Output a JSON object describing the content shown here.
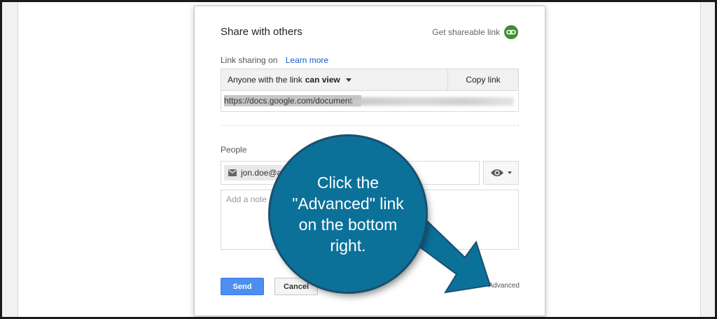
{
  "dialog": {
    "title": "Share with others",
    "shareable_link_label": "Get shareable link"
  },
  "link_sharing": {
    "status_label": "Link sharing on",
    "learn_more_label": "Learn more",
    "access_prefix": "Anyone with the link",
    "access_level": "can view",
    "copy_link_label": "Copy link",
    "url_visible": "https://docs.google.com/document/d/"
  },
  "people": {
    "label": "People",
    "chip_email": "jon.doe@ap",
    "note_placeholder": "Add a note"
  },
  "footer": {
    "send_label": "Send",
    "cancel_label": "Cancel",
    "advanced_label": "Advanced"
  },
  "callout": {
    "text": "Click the \"Advanced\" link on the bottom right."
  },
  "colors": {
    "accent_blue": "#4d8ef0",
    "link_green": "#3f8f2f",
    "callout_blue": "#0c7199"
  }
}
